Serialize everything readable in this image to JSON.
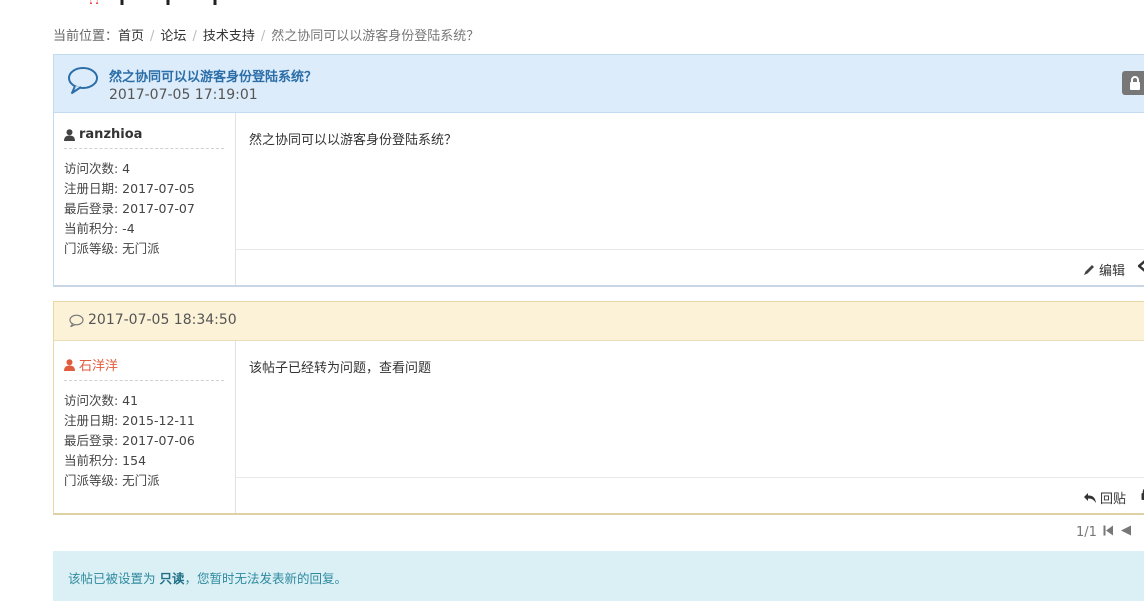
{
  "breadcrumb": {
    "prefix": "当前位置：",
    "items": [
      "首页",
      "论坛",
      "技术支持"
    ],
    "current": "然之协同可以以游客身份登陆系统？"
  },
  "thread": {
    "title": "然之协同可以以游客身份登陆系统？",
    "date": "2017-07-05 17:19:01",
    "author": {
      "name": "ranzhioa",
      "visits": "访问次数: 4",
      "registered": "注册日期: 2017-07-05",
      "last_login": "最后登录: 2017-07-07",
      "points": "当前积分: -4",
      "rank": "门派等级: 无门派"
    },
    "content": "然之协同可以以游客身份登陆系统？",
    "edit_label": "编辑"
  },
  "reply": {
    "date": "2017-07-05 18:34:50",
    "author": {
      "name": "石洋洋",
      "visits": "访问次数: 41",
      "registered": "注册日期: 2015-12-11",
      "last_login": "最后登录: 2017-07-06",
      "points": "当前积分: 154",
      "rank": "门派等级: 无门派"
    },
    "content": "该帖子已经转为问题，查看问题",
    "reply_label": "回贴"
  },
  "pager": {
    "label": "1/1"
  },
  "notice": {
    "before": "该帖已被设置为 ",
    "strong": "只读",
    "after": "，您暂时无法发表新的回复。"
  },
  "colors": {
    "thread_header_bg": "#ddecfa",
    "reply_header_bg": "#fbf2d8",
    "notice_bg": "#dbf0f4",
    "title_blue": "#2b6ea8",
    "reply_author": "#e05c3c"
  }
}
